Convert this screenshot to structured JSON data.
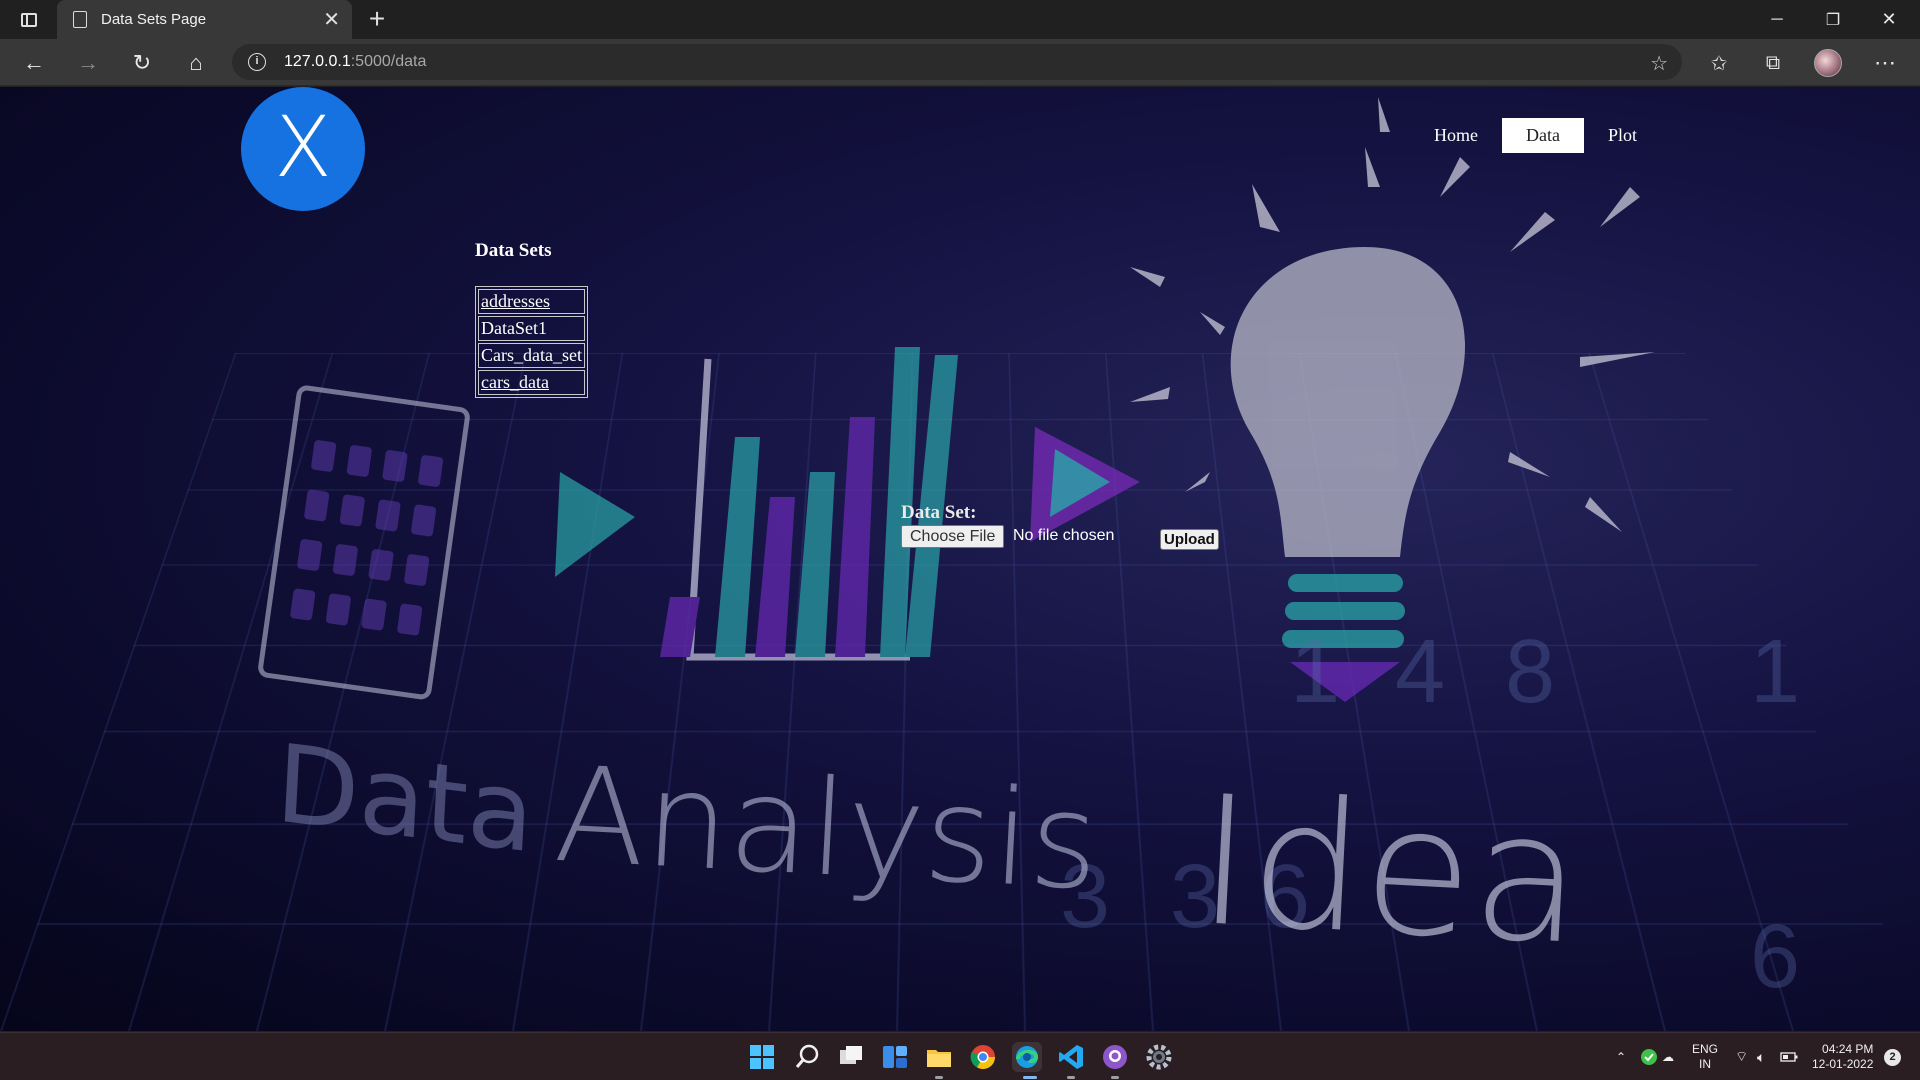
{
  "browser": {
    "tab_title": "Data Sets Page",
    "url_host": "127.0.0.1",
    "url_path": ":5000/data"
  },
  "site": {
    "logo_glyph": "X",
    "nav": [
      {
        "label": "Home",
        "active": false
      },
      {
        "label": "Data",
        "active": true
      },
      {
        "label": "Plot",
        "active": false
      }
    ],
    "datasets_heading": "Data Sets",
    "datasets": [
      "addresses",
      "DataSet1",
      "Cars_data_set",
      "cars_data"
    ],
    "upload": {
      "label": "Data Set:",
      "choose_button": "Choose File",
      "file_status": "No file chosen",
      "submit_label": "Upload"
    },
    "background_words": [
      "Data",
      "Analysis",
      "Idea"
    ]
  },
  "taskbar": {
    "lang_top": "ENG",
    "lang_bottom": "IN",
    "time": "04:24 PM",
    "date": "12-01-2022",
    "notification_count": "2"
  },
  "colors": {
    "logo_blue": "#1572e0",
    "nav_active_bg": "#ffffff",
    "page_bg": "#0b0a2a"
  }
}
